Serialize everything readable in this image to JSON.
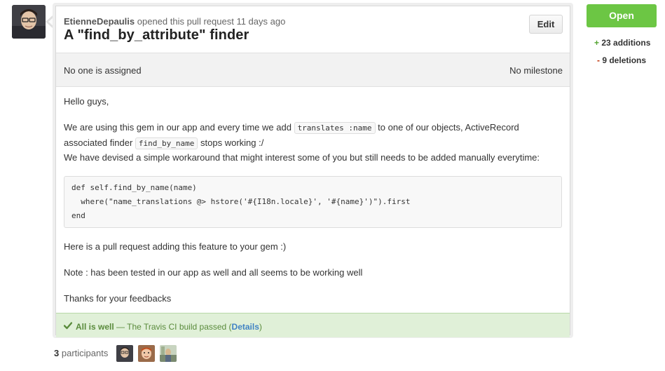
{
  "comment": {
    "author": "EtienneDepaulis",
    "action": "opened this pull request",
    "time": "11 days ago",
    "title": "A \"find_by_attribute\" finder",
    "edit_label": "Edit"
  },
  "info": {
    "assignee": "No one is assigned",
    "milestone": "No milestone"
  },
  "body": {
    "greeting": "Hello guys,",
    "p1_a": "We are using this gem in our app and every time we add",
    "p1_code1": "translates :name",
    "p1_b": "to one of our objects, ActiveRecord",
    "p1_c": "associated finder",
    "p1_code2": "find_by_name",
    "p1_d": "stops working :/",
    "p2": "We have devised a simple workaround that might interest some of you but still needs to be added manually everytime:",
    "code_lines": [
      "def self.find_by_name(name)",
      "  where(\"name_translations @> hstore('#{I18n.locale}', '#{name}')\").first",
      "end"
    ],
    "p3": "Here is a pull request adding this feature to your gem :)",
    "p4": "Note : has been tested in our app as well and all seems to be working well",
    "p5": "Thanks for your feedbacks"
  },
  "status": {
    "label": "All is well",
    "message": "— The Travis CI build passed (",
    "details": "Details",
    "close": ")",
    "color": "#6cc644"
  },
  "participants": {
    "count": "3",
    "label": "participants"
  },
  "sidebar": {
    "state": "Open",
    "additions_count": "23 additions",
    "additions_sign": "+",
    "deletions_count": "9 deletions",
    "deletions_sign": "-"
  },
  "icons": {
    "status": "check-icon"
  }
}
